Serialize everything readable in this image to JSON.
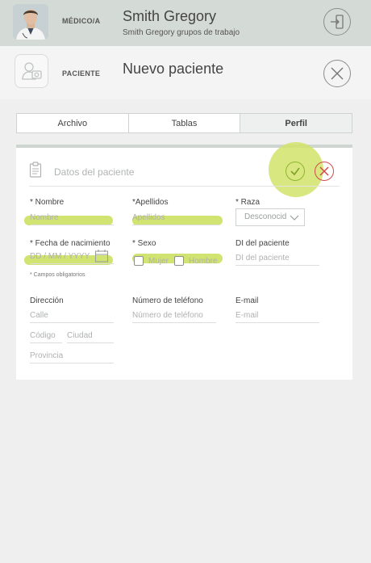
{
  "doctor": {
    "role": "MÉDICO/A",
    "name": "Smith Gregory",
    "subtitle": "Smith Gregory grupos de trabajo"
  },
  "patient_header": {
    "role": "PACIENTE",
    "title": "Nuevo paciente"
  },
  "tabs": [
    {
      "label": "Archivo",
      "active": false
    },
    {
      "label": "Tablas",
      "active": false
    },
    {
      "label": "Perfil",
      "active": true
    }
  ],
  "card": {
    "title": "Datos del paciente",
    "fields": {
      "nombre": {
        "label": "* Nombre",
        "placeholder": "Nombre"
      },
      "apellidos": {
        "label": "*Apellidos",
        "placeholder": "Apellidos"
      },
      "raza": {
        "label": "* Raza",
        "value": "Desconocid"
      },
      "fecha": {
        "label": "* Fecha de nacimiento",
        "placeholder": "DD / MM / YYYY"
      },
      "sexo": {
        "label": "* Sexo",
        "option_mujer": "Mujer",
        "option_hombre": "Hombre"
      },
      "di": {
        "label": "DI del paciente",
        "placeholder": "DI del paciente"
      },
      "required_note": "* Campos obligatorios",
      "direccion": {
        "label": "Dirección",
        "calle": "Calle",
        "codigo": "Código",
        "ciudad": "Ciudad",
        "provincia": "Provincia"
      },
      "telefono": {
        "label": "Número de teléfono",
        "placeholder": "Número de teléfono"
      },
      "email": {
        "label": "E-mail",
        "placeholder": "E-mail"
      }
    }
  },
  "colors": {
    "accent_green": "#c9de57",
    "confirm_green": "#8fb42d",
    "cancel_red": "#d04b4b"
  }
}
